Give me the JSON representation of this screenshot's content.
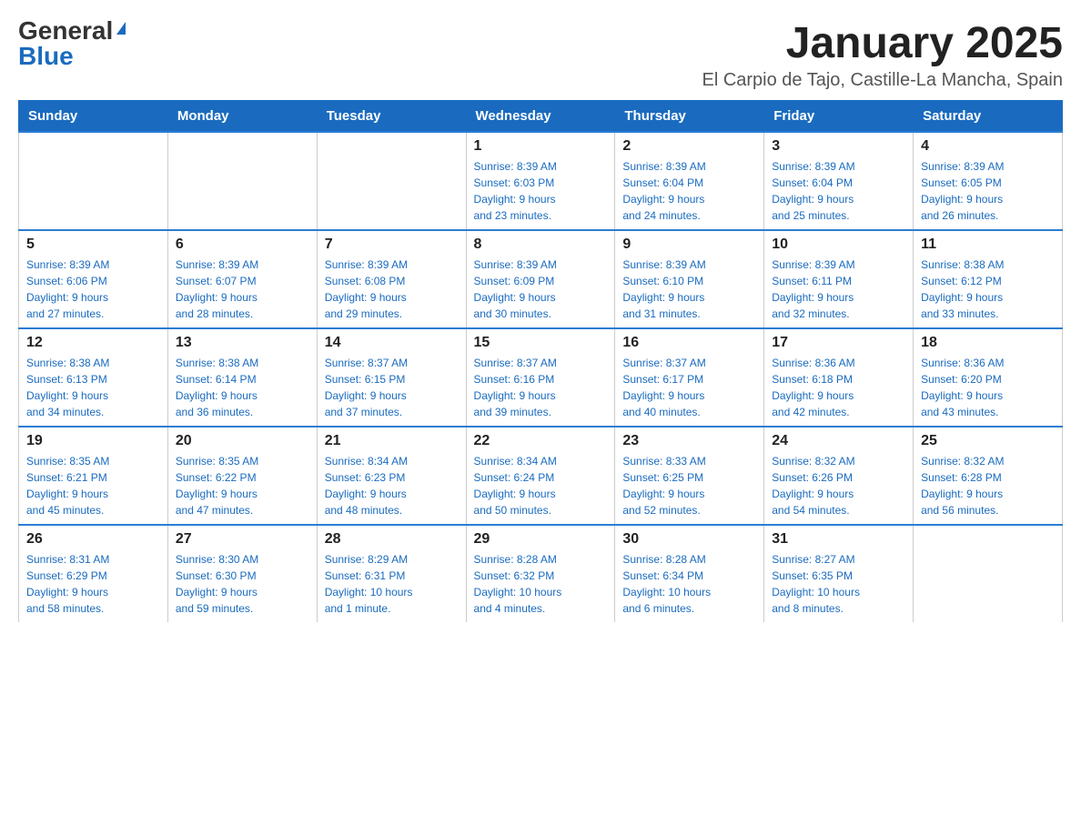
{
  "logo": {
    "general": "General",
    "blue": "Blue"
  },
  "title": "January 2025",
  "location": "El Carpio de Tajo, Castille-La Mancha, Spain",
  "days_of_week": [
    "Sunday",
    "Monday",
    "Tuesday",
    "Wednesday",
    "Thursday",
    "Friday",
    "Saturday"
  ],
  "weeks": [
    [
      {
        "day": "",
        "info": ""
      },
      {
        "day": "",
        "info": ""
      },
      {
        "day": "",
        "info": ""
      },
      {
        "day": "1",
        "info": "Sunrise: 8:39 AM\nSunset: 6:03 PM\nDaylight: 9 hours\nand 23 minutes."
      },
      {
        "day": "2",
        "info": "Sunrise: 8:39 AM\nSunset: 6:04 PM\nDaylight: 9 hours\nand 24 minutes."
      },
      {
        "day": "3",
        "info": "Sunrise: 8:39 AM\nSunset: 6:04 PM\nDaylight: 9 hours\nand 25 minutes."
      },
      {
        "day": "4",
        "info": "Sunrise: 8:39 AM\nSunset: 6:05 PM\nDaylight: 9 hours\nand 26 minutes."
      }
    ],
    [
      {
        "day": "5",
        "info": "Sunrise: 8:39 AM\nSunset: 6:06 PM\nDaylight: 9 hours\nand 27 minutes."
      },
      {
        "day": "6",
        "info": "Sunrise: 8:39 AM\nSunset: 6:07 PM\nDaylight: 9 hours\nand 28 minutes."
      },
      {
        "day": "7",
        "info": "Sunrise: 8:39 AM\nSunset: 6:08 PM\nDaylight: 9 hours\nand 29 minutes."
      },
      {
        "day": "8",
        "info": "Sunrise: 8:39 AM\nSunset: 6:09 PM\nDaylight: 9 hours\nand 30 minutes."
      },
      {
        "day": "9",
        "info": "Sunrise: 8:39 AM\nSunset: 6:10 PM\nDaylight: 9 hours\nand 31 minutes."
      },
      {
        "day": "10",
        "info": "Sunrise: 8:39 AM\nSunset: 6:11 PM\nDaylight: 9 hours\nand 32 minutes."
      },
      {
        "day": "11",
        "info": "Sunrise: 8:38 AM\nSunset: 6:12 PM\nDaylight: 9 hours\nand 33 minutes."
      }
    ],
    [
      {
        "day": "12",
        "info": "Sunrise: 8:38 AM\nSunset: 6:13 PM\nDaylight: 9 hours\nand 34 minutes."
      },
      {
        "day": "13",
        "info": "Sunrise: 8:38 AM\nSunset: 6:14 PM\nDaylight: 9 hours\nand 36 minutes."
      },
      {
        "day": "14",
        "info": "Sunrise: 8:37 AM\nSunset: 6:15 PM\nDaylight: 9 hours\nand 37 minutes."
      },
      {
        "day": "15",
        "info": "Sunrise: 8:37 AM\nSunset: 6:16 PM\nDaylight: 9 hours\nand 39 minutes."
      },
      {
        "day": "16",
        "info": "Sunrise: 8:37 AM\nSunset: 6:17 PM\nDaylight: 9 hours\nand 40 minutes."
      },
      {
        "day": "17",
        "info": "Sunrise: 8:36 AM\nSunset: 6:18 PM\nDaylight: 9 hours\nand 42 minutes."
      },
      {
        "day": "18",
        "info": "Sunrise: 8:36 AM\nSunset: 6:20 PM\nDaylight: 9 hours\nand 43 minutes."
      }
    ],
    [
      {
        "day": "19",
        "info": "Sunrise: 8:35 AM\nSunset: 6:21 PM\nDaylight: 9 hours\nand 45 minutes."
      },
      {
        "day": "20",
        "info": "Sunrise: 8:35 AM\nSunset: 6:22 PM\nDaylight: 9 hours\nand 47 minutes."
      },
      {
        "day": "21",
        "info": "Sunrise: 8:34 AM\nSunset: 6:23 PM\nDaylight: 9 hours\nand 48 minutes."
      },
      {
        "day": "22",
        "info": "Sunrise: 8:34 AM\nSunset: 6:24 PM\nDaylight: 9 hours\nand 50 minutes."
      },
      {
        "day": "23",
        "info": "Sunrise: 8:33 AM\nSunset: 6:25 PM\nDaylight: 9 hours\nand 52 minutes."
      },
      {
        "day": "24",
        "info": "Sunrise: 8:32 AM\nSunset: 6:26 PM\nDaylight: 9 hours\nand 54 minutes."
      },
      {
        "day": "25",
        "info": "Sunrise: 8:32 AM\nSunset: 6:28 PM\nDaylight: 9 hours\nand 56 minutes."
      }
    ],
    [
      {
        "day": "26",
        "info": "Sunrise: 8:31 AM\nSunset: 6:29 PM\nDaylight: 9 hours\nand 58 minutes."
      },
      {
        "day": "27",
        "info": "Sunrise: 8:30 AM\nSunset: 6:30 PM\nDaylight: 9 hours\nand 59 minutes."
      },
      {
        "day": "28",
        "info": "Sunrise: 8:29 AM\nSunset: 6:31 PM\nDaylight: 10 hours\nand 1 minute."
      },
      {
        "day": "29",
        "info": "Sunrise: 8:28 AM\nSunset: 6:32 PM\nDaylight: 10 hours\nand 4 minutes."
      },
      {
        "day": "30",
        "info": "Sunrise: 8:28 AM\nSunset: 6:34 PM\nDaylight: 10 hours\nand 6 minutes."
      },
      {
        "day": "31",
        "info": "Sunrise: 8:27 AM\nSunset: 6:35 PM\nDaylight: 10 hours\nand 8 minutes."
      },
      {
        "day": "",
        "info": ""
      }
    ]
  ]
}
